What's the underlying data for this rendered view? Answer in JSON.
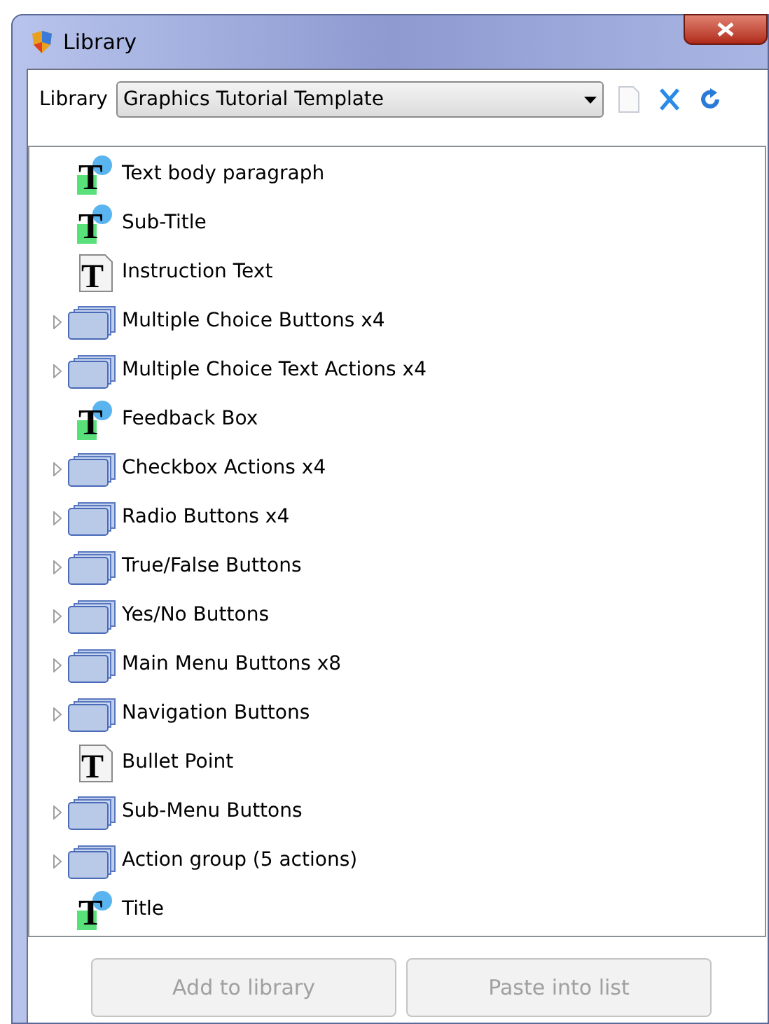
{
  "window": {
    "title": "Library"
  },
  "toolbar": {
    "label": "Library",
    "dropdown": {
      "value": "Graphics Tutorial Template"
    }
  },
  "tree": [
    {
      "kind": "styled",
      "icon_glyph": "T",
      "label": "Text body paragraph"
    },
    {
      "kind": "styled",
      "icon_glyph": "T",
      "label": "Sub-Title"
    },
    {
      "kind": "doc",
      "icon_glyph": "T",
      "label": "Instruction Text"
    },
    {
      "kind": "group",
      "label": "Multiple Choice Buttons x4",
      "expanded": false
    },
    {
      "kind": "group",
      "label": "Multiple Choice Text Actions x4",
      "expanded": false
    },
    {
      "kind": "styled",
      "icon_glyph": "T",
      "label": "Feedback Box"
    },
    {
      "kind": "group",
      "label": "Checkbox Actions x4",
      "expanded": false
    },
    {
      "kind": "group",
      "label": "Radio Buttons x4",
      "expanded": false
    },
    {
      "kind": "group",
      "label": "True/False Buttons",
      "expanded": false
    },
    {
      "kind": "group",
      "label": "Yes/No Buttons",
      "expanded": false
    },
    {
      "kind": "group",
      "label": "Main Menu Buttons x8",
      "expanded": false
    },
    {
      "kind": "group",
      "label": "Navigation Buttons",
      "expanded": false
    },
    {
      "kind": "doc",
      "icon_glyph": "T",
      "label": "Bullet Point"
    },
    {
      "kind": "group",
      "label": "Sub-Menu Buttons",
      "expanded": false
    },
    {
      "kind": "group",
      "label": "Action group (5 actions)",
      "expanded": false
    },
    {
      "kind": "styled",
      "icon_glyph": "T",
      "label": "Title"
    }
  ],
  "buttons": [
    {
      "label": "Add to library",
      "disabled": true
    },
    {
      "label": "Paste into list",
      "disabled": true
    }
  ]
}
